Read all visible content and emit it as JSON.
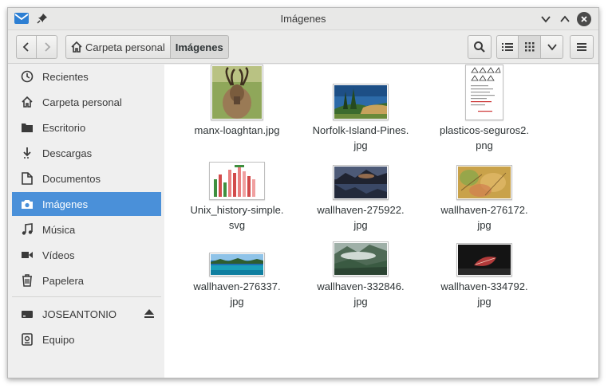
{
  "window": {
    "title": "Imágenes"
  },
  "toolbar": {
    "breadcrumb": [
      "Carpeta personal",
      "Imágenes"
    ]
  },
  "sidebar": {
    "places": [
      {
        "label": "Recientes",
        "icon": "clock-icon"
      },
      {
        "label": "Carpeta personal",
        "icon": "home-icon"
      },
      {
        "label": "Escritorio",
        "icon": "folder-icon"
      },
      {
        "label": "Descargas",
        "icon": "download-icon"
      },
      {
        "label": "Documentos",
        "icon": "document-icon"
      },
      {
        "label": "Imágenes",
        "icon": "camera-icon",
        "selected": true
      },
      {
        "label": "Música",
        "icon": "music-icon"
      },
      {
        "label": "Vídeos",
        "icon": "video-icon"
      },
      {
        "label": "Papelera",
        "icon": "trash-icon"
      }
    ],
    "devices": [
      {
        "label": "JOSEANTONIO",
        "icon": "drive-icon"
      },
      {
        "label": "Equipo",
        "icon": "computer-icon"
      }
    ]
  },
  "files": [
    {
      "name_l1": "manx-loaghtan.jpg",
      "name_l2": ""
    },
    {
      "name_l1": "Norfolk-Island-Pines.",
      "name_l2": "jpg"
    },
    {
      "name_l1": "plasticos-seguros2.",
      "name_l2": "png"
    },
    {
      "name_l1": "Unix_history-simple.",
      "name_l2": "svg"
    },
    {
      "name_l1": "wallhaven-275922.",
      "name_l2": "jpg"
    },
    {
      "name_l1": "wallhaven-276172.",
      "name_l2": "jpg"
    },
    {
      "name_l1": "wallhaven-276337.",
      "name_l2": "jpg"
    },
    {
      "name_l1": "wallhaven-332846.",
      "name_l2": "jpg"
    },
    {
      "name_l1": "wallhaven-334792.",
      "name_l2": "jpg"
    }
  ],
  "colors": {
    "selection": "#4a90d9",
    "titlebar": "#e8e8e7"
  }
}
